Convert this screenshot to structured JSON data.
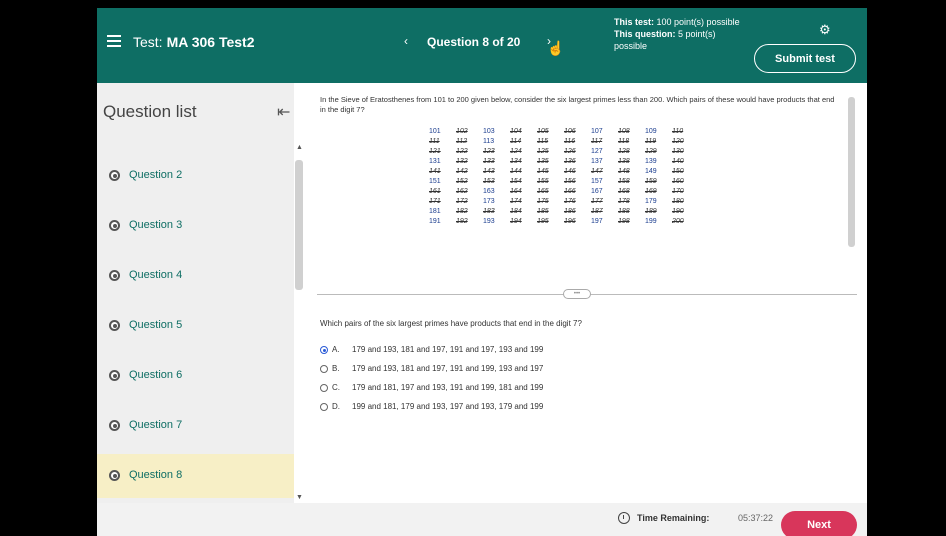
{
  "header": {
    "test_prefix": "Test:",
    "test_name": "MA 306 Test2",
    "prev_arrow": "‹",
    "question_counter": "Question 8 of 20",
    "next_arrow": "›",
    "points_test_label": "This test:",
    "points_test_value": "100 point(s) possible",
    "points_question_label": "This question:",
    "points_question_value": "5 point(s) possible",
    "submit_label": "Submit test",
    "bg_color": "#0e6e64"
  },
  "sidebar": {
    "title": "Question list",
    "items": [
      {
        "label": "Question 2"
      },
      {
        "label": "Question 3"
      },
      {
        "label": "Question 4"
      },
      {
        "label": "Question 5"
      },
      {
        "label": "Question 6"
      },
      {
        "label": "Question 7"
      },
      {
        "label": "Question 8",
        "current": true
      }
    ]
  },
  "problem": {
    "stem": "In the Sieve of Eratosthenes from 101 to 200 given below, consider the six largest primes less than 200. Which pairs of these would have products that end in the digit 7?",
    "sieve_rows": [
      [
        "101",
        "102",
        "103",
        "104",
        "105",
        "106",
        "107",
        "108",
        "109",
        "110"
      ],
      [
        "111",
        "112",
        "113",
        "114",
        "115",
        "116",
        "117",
        "118",
        "119",
        "120"
      ],
      [
        "121",
        "122",
        "123",
        "124",
        "125",
        "126",
        "127",
        "128",
        "129",
        "130"
      ],
      [
        "131",
        "132",
        "133",
        "134",
        "135",
        "136",
        "137",
        "138",
        "139",
        "140"
      ],
      [
        "141",
        "142",
        "143",
        "144",
        "145",
        "146",
        "147",
        "148",
        "149",
        "150"
      ],
      [
        "151",
        "152",
        "153",
        "154",
        "155",
        "156",
        "157",
        "158",
        "159",
        "160"
      ],
      [
        "161",
        "162",
        "163",
        "164",
        "165",
        "166",
        "167",
        "168",
        "169",
        "170"
      ],
      [
        "171",
        "172",
        "173",
        "174",
        "175",
        "176",
        "177",
        "178",
        "179",
        "180"
      ],
      [
        "181",
        "182",
        "183",
        "184",
        "185",
        "186",
        "187",
        "188",
        "189",
        "190"
      ],
      [
        "191",
        "192",
        "193",
        "194",
        "195",
        "196",
        "197",
        "198",
        "199",
        "200"
      ]
    ],
    "primes": [
      "101",
      "103",
      "107",
      "109",
      "113",
      "127",
      "131",
      "137",
      "139",
      "149",
      "151",
      "157",
      "163",
      "167",
      "173",
      "179",
      "181",
      "191",
      "193",
      "197",
      "199"
    ],
    "question": "Which pairs of the six largest primes have products that end in the digit 7?",
    "options": [
      {
        "letter": "A.",
        "text": "179 and 193, 181 and 197, 191 and 197, 193 and 199",
        "selected": true
      },
      {
        "letter": "B.",
        "text": "179 and 193, 181 and 197, 191 and 199, 193 and 197",
        "selected": false
      },
      {
        "letter": "C.",
        "text": "179 and 181, 197 and 193, 191 and 199, 181 and 199",
        "selected": false
      },
      {
        "letter": "D.",
        "text": "199 and 181, 179 and 193, 197 and 193, 179 and 199",
        "selected": false
      }
    ]
  },
  "footer": {
    "time_label": "Time Remaining:",
    "time_value": "05:37:22",
    "next_label": "Next",
    "next_color": "#d8365b"
  }
}
